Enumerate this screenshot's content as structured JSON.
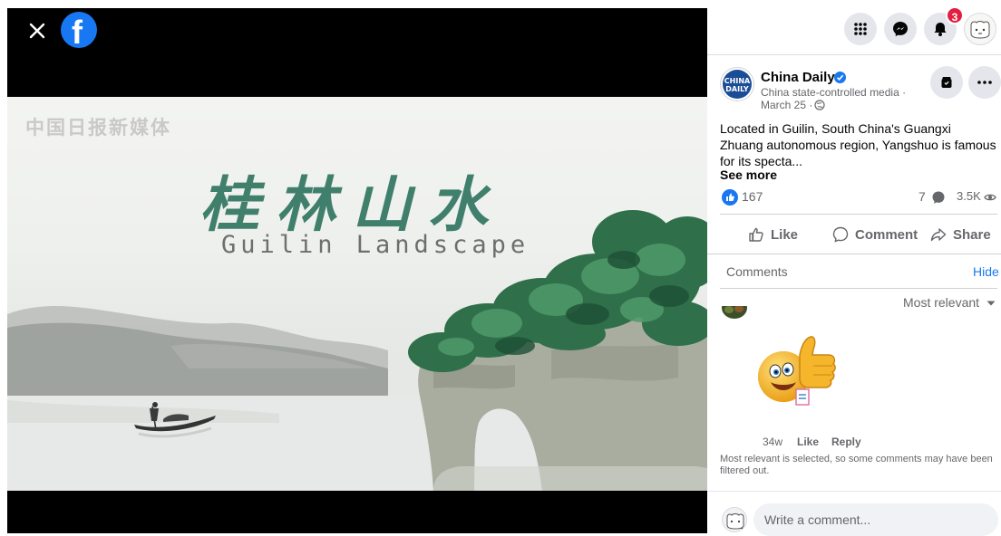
{
  "viewer": {
    "watermark": "中国日报新媒体",
    "title_cn": "桂林山水",
    "title_en": "Guilin Landscape"
  },
  "header": {
    "notification_count": "3",
    "icons": [
      "menu-grid-icon",
      "messenger-icon",
      "bell-icon",
      "profile-avatar"
    ]
  },
  "post": {
    "page_name": "China Daily",
    "page_avatar_text": "CHINA DAILY",
    "subtitle": "China state-controlled media ·",
    "date": "March 25 ·",
    "text": "Located in Guilin, South China's Guangxi Zhuang autonomous region, Yangshuo is famous for its specta...",
    "see_more": "See more",
    "like_count": "167",
    "comment_count": "7",
    "view_count": "3.5K"
  },
  "actions": {
    "like": "Like",
    "comment": "Comment",
    "share": "Share"
  },
  "comments": {
    "label": "Comments",
    "hide": "Hide",
    "sort": "Most relevant",
    "items": [
      {
        "sticker": "thumbs-up-smiley-sticker",
        "time": "34w",
        "like": "Like",
        "reply": "Reply"
      }
    ],
    "filter_notice": "Most relevant is selected, so some comments may have been filtered out.",
    "composer_placeholder": "Write a comment..."
  },
  "colors": {
    "facebook_blue": "#1877f2",
    "badge_red": "#e41e3f",
    "title_green": "#3f7f6b",
    "muted_text": "#65676b"
  }
}
